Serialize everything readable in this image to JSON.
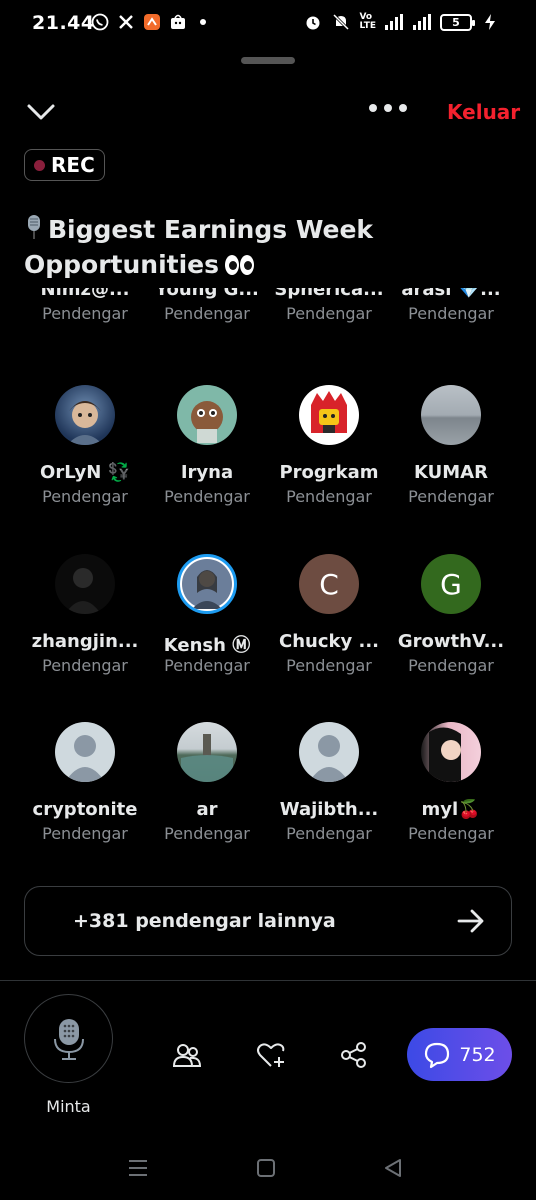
{
  "status_bar": {
    "time": "21.44",
    "left_icons": [
      "whatsapp-icon",
      "x-icon",
      "app-icon",
      "shop-icon"
    ],
    "network_small": "Vo\nLTE",
    "network_type": "4G",
    "battery": "5"
  },
  "header": {
    "leave_label": "Keluar",
    "rec_label": "REC"
  },
  "space": {
    "title": "Biggest Earnings Week Opportunities"
  },
  "participants_partial": [
    {
      "name": "Nimz@...",
      "role": "Pendengar"
    },
    {
      "name": "Young G...",
      "role": "Pendengar"
    },
    {
      "name": "Spherica...",
      "role": "Pendengar"
    },
    {
      "name": "arasi 💎...",
      "role": "Pendengar"
    }
  ],
  "participants": [
    {
      "name": "OrLyN 💱",
      "role": "Pendengar"
    },
    {
      "name": "Iryna",
      "role": "Pendengar"
    },
    {
      "name": "Progrkam",
      "role": "Pendengar"
    },
    {
      "name": "KUMAR",
      "role": "Pendengar"
    },
    {
      "name": "zhangjin...",
      "role": "Pendengar"
    },
    {
      "name": "Kensh Ⓜ",
      "role": "Pendengar"
    },
    {
      "name": "Chucky ...",
      "role": "Pendengar",
      "initial": "C"
    },
    {
      "name": "GrowthV...",
      "role": "Pendengar",
      "initial": "G"
    },
    {
      "name": "cryptonite",
      "role": "Pendengar"
    },
    {
      "name": "ar",
      "role": "Pendengar"
    },
    {
      "name": "Wajibth...",
      "role": "Pendengar"
    },
    {
      "name": "myl🍒",
      "role": "Pendengar"
    }
  ],
  "more_listeners": {
    "label": "+381 pendengar lainnya"
  },
  "bottom_bar": {
    "request_label": "Minta",
    "chat_count": "752"
  },
  "colors": {
    "accent_red": "#f4212e",
    "chat_gradient_start": "#3c4ae6",
    "chat_gradient_end": "#6d4ee8",
    "muted_text": "#8b8f94"
  }
}
